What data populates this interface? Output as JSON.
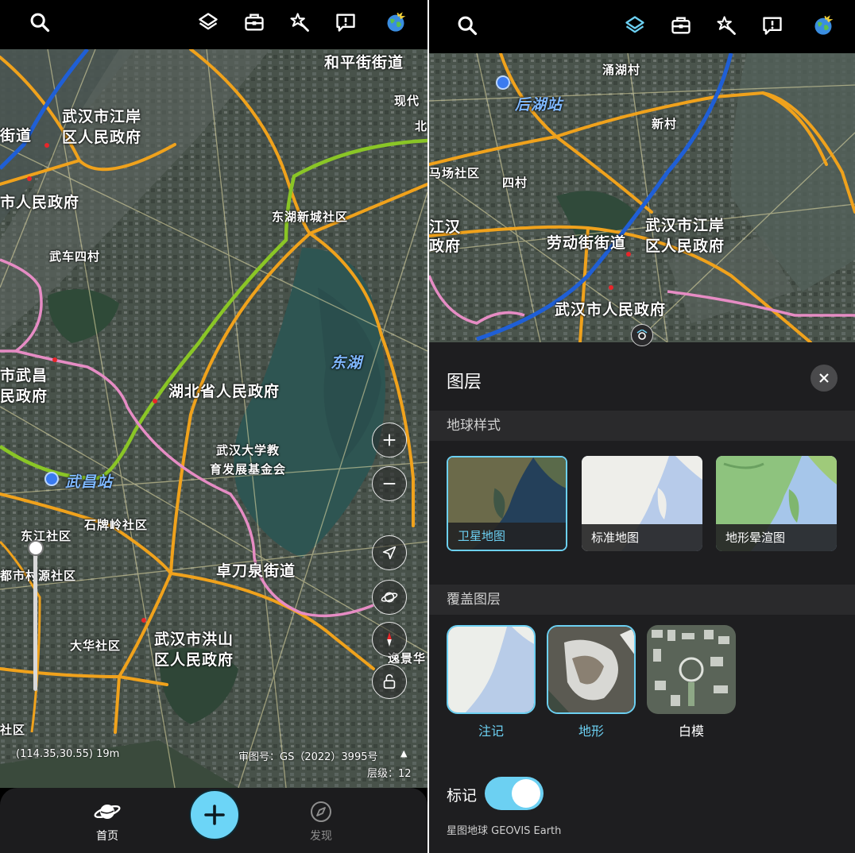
{
  "left": {
    "places": [
      {
        "id": "heping",
        "text": "和平街街道"
      },
      {
        "id": "xiandai",
        "text": "现代"
      },
      {
        "id": "bei",
        "text": "北"
      },
      {
        "id": "jiangan1",
        "text": "武汉市江岸"
      },
      {
        "id": "jiangan2",
        "text": "区人民政府"
      },
      {
        "id": "jiedao",
        "text": "街道"
      },
      {
        "id": "shirenmin",
        "text": "市人民政府"
      },
      {
        "id": "donghuxincheng",
        "text": "东湖新城社区"
      },
      {
        "id": "wuche",
        "text": "武车四村"
      },
      {
        "id": "donghu",
        "text": "东湖"
      },
      {
        "id": "shiwuchang1",
        "text": "市武昌"
      },
      {
        "id": "shiwuchang2",
        "text": "民政府"
      },
      {
        "id": "hubei",
        "text": "湖北省人民政府"
      },
      {
        "id": "whu1",
        "text": "武汉大学教"
      },
      {
        "id": "whu2",
        "text": "育发展基金会"
      },
      {
        "id": "wuchangzhan",
        "text": "武昌站"
      },
      {
        "id": "shidong",
        "text": "石牌岭社区"
      },
      {
        "id": "dongjiang",
        "text": "东江社区"
      },
      {
        "id": "dushi",
        "text": "都市村源社区"
      },
      {
        "id": "zhuodaoquan",
        "text": "卓刀泉街道"
      },
      {
        "id": "dahua",
        "text": "大华社区"
      },
      {
        "id": "hongshan1",
        "text": "武汉市洪山"
      },
      {
        "id": "hongshan2",
        "text": "区人民政府"
      },
      {
        "id": "luoshe",
        "text": "逸景华"
      },
      {
        "id": "shequ",
        "text": "社区"
      }
    ],
    "coords": "(114.35,30.55) 19m",
    "gs_number": "审图号：GS（2022）3995号",
    "level": "层级：12",
    "nav": {
      "home": "首页",
      "discover": "发现"
    }
  },
  "right": {
    "places": [
      {
        "id": "xiaohu",
        "text": "涌湖村"
      },
      {
        "id": "houhu",
        "text": "后湖站"
      },
      {
        "id": "xincun",
        "text": "新村"
      },
      {
        "id": "mayi",
        "text": "马场社区"
      },
      {
        "id": "sicun",
        "text": "四村"
      },
      {
        "id": "jianghan1",
        "text": "江汉"
      },
      {
        "id": "jianghan2",
        "text": "政府"
      },
      {
        "id": "laodong",
        "text": "劳动街街道"
      },
      {
        "id": "jiangan1",
        "text": "武汉市江岸"
      },
      {
        "id": "jiangan2",
        "text": "区人民政府"
      },
      {
        "id": "shirenmin",
        "text": "武汉市人民政府"
      }
    ],
    "panel": {
      "title": "图层",
      "globe_style_header": "地球样式",
      "styles": [
        {
          "label": "卫星地图",
          "selected": true
        },
        {
          "label": "标准地图",
          "selected": false
        },
        {
          "label": "地形晕渲图",
          "selected": false
        }
      ],
      "overlay_header": "覆盖图层",
      "overlays": [
        {
          "label": "注记",
          "selected": true
        },
        {
          "label": "地形",
          "selected": true
        },
        {
          "label": "白模",
          "selected": false
        }
      ],
      "marker_label": "标记",
      "marker_on": true,
      "brand": "星图地球 GEOVIS Earth"
    }
  },
  "colors": {
    "accent": "#6cd0f2",
    "metro_blue": "#1f5fd6",
    "road_orange": "#f0a21c",
    "metro_green": "#8ac626",
    "metro_pink": "#e68cc4"
  },
  "icons": [
    "search-icon",
    "layers-icon",
    "toolbox-icon",
    "magic-wand-icon",
    "feedback-icon",
    "globe-avatar-icon",
    "zoom-in-icon",
    "zoom-out-icon",
    "navigate-icon",
    "planet-icon",
    "compass-icon",
    "lock-icon",
    "home-planet-icon",
    "add-icon",
    "discover-compass-icon",
    "close-icon"
  ]
}
